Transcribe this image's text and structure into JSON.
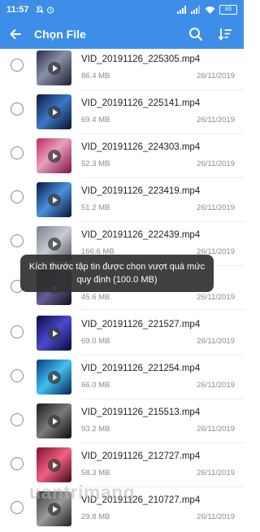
{
  "status": {
    "time": "11:57",
    "battery": "83"
  },
  "appbar": {
    "title": "Chọn File"
  },
  "files": [
    {
      "name": "VID_20191126_225305.mp4",
      "size": "86.4 MB",
      "date": "26/11/2019"
    },
    {
      "name": "VID_20191126_225141.mp4",
      "size": "69.4 MB",
      "date": "26/11/2019"
    },
    {
      "name": "VID_20191126_224303.mp4",
      "size": "52.3 MB",
      "date": "26/11/2019"
    },
    {
      "name": "VID_20191126_223419.mp4",
      "size": "51.2 MB",
      "date": "26/11/2019"
    },
    {
      "name": "VID_20191126_222439.mp4",
      "size": "166.6 MB",
      "date": "26/11/2019"
    },
    {
      "name": "",
      "size": "45.6 MB",
      "date": "26/11/2019"
    },
    {
      "name": "VID_20191126_221527.mp4",
      "size": "69.0 MB",
      "date": "26/11/2019"
    },
    {
      "name": "VID_20191126_221254.mp4",
      "size": "66.0 MB",
      "date": "26/11/2019"
    },
    {
      "name": "VID_20191126_215513.mp4",
      "size": "93.2 MB",
      "date": "26/11/2019"
    },
    {
      "name": "VID_20191126_212727.mp4",
      "size": "58.3 MB",
      "date": "26/11/2019"
    },
    {
      "name": "VID_20191126_210727.mp4",
      "size": "29.8 MB",
      "date": "26/11/2019"
    }
  ],
  "toast": {
    "message": "Kích thước tập tin được chọn vượt quá mức quy định (100.0 MB)"
  },
  "watermark": "uantrimang"
}
